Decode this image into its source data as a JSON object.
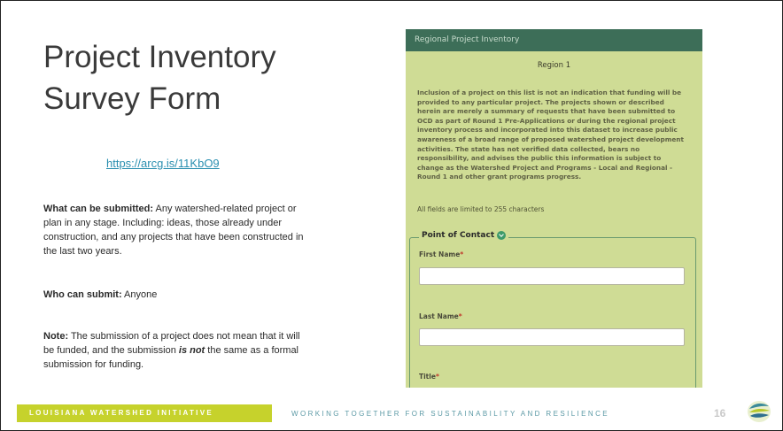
{
  "slide": {
    "title_line1": "Project Inventory",
    "title_line2": "Survey Form",
    "link": "https://arcg.is/11KbO9",
    "paragraphs": {
      "what_label": "What can be submitted:",
      "what_text": " Any watershed-related project or plan in any stage. Including: ideas, those already under construction, and any projects that have been constructed in the last two years.",
      "who_label": "Who can submit:",
      "who_text": " Anyone",
      "note_label": "Note:",
      "note_text_a": " The submission of a project does not mean that it will be funded, and the submission ",
      "note_emph": "is not",
      "note_text_b": " the same as a formal submission for funding."
    }
  },
  "form": {
    "header": "Regional Project Inventory",
    "region": "Region 1",
    "disclaimer": "Inclusion of a project on this list is not an indication that funding will be provided to any particular project. The projects shown or described herein are merely a summary of requests that have been submitted to OCD as part of Round 1 Pre-Applications or during the regional project inventory process and incorporated into this dataset to increase public awareness of a broad range of proposed watershed project development activities. The state has not verified data collected, bears no responsibility, and advises the public this information is subject to change as the Watershed Project and Programs - Local and Regional - Round 1 and other grant programs progress.",
    "limit_note": "All fields are limited to 255 characters",
    "section": "Point of Contact",
    "fields": {
      "first_name": "First Name",
      "last_name": "Last Name",
      "title": "Title",
      "required_mark": "*"
    }
  },
  "footer": {
    "brand": "LOUISIANA WATERSHED INITIATIVE",
    "tagline": "WORKING TOGETHER FOR SUSTAINABILITY AND RESILIENCE",
    "page_number": "16"
  },
  "colors": {
    "brand_green": "#c6d22c",
    "form_bg": "#cfdc95",
    "form_header": "#3d6e58",
    "link": "#2a8fb0",
    "tagline": "#5d9aa6"
  }
}
